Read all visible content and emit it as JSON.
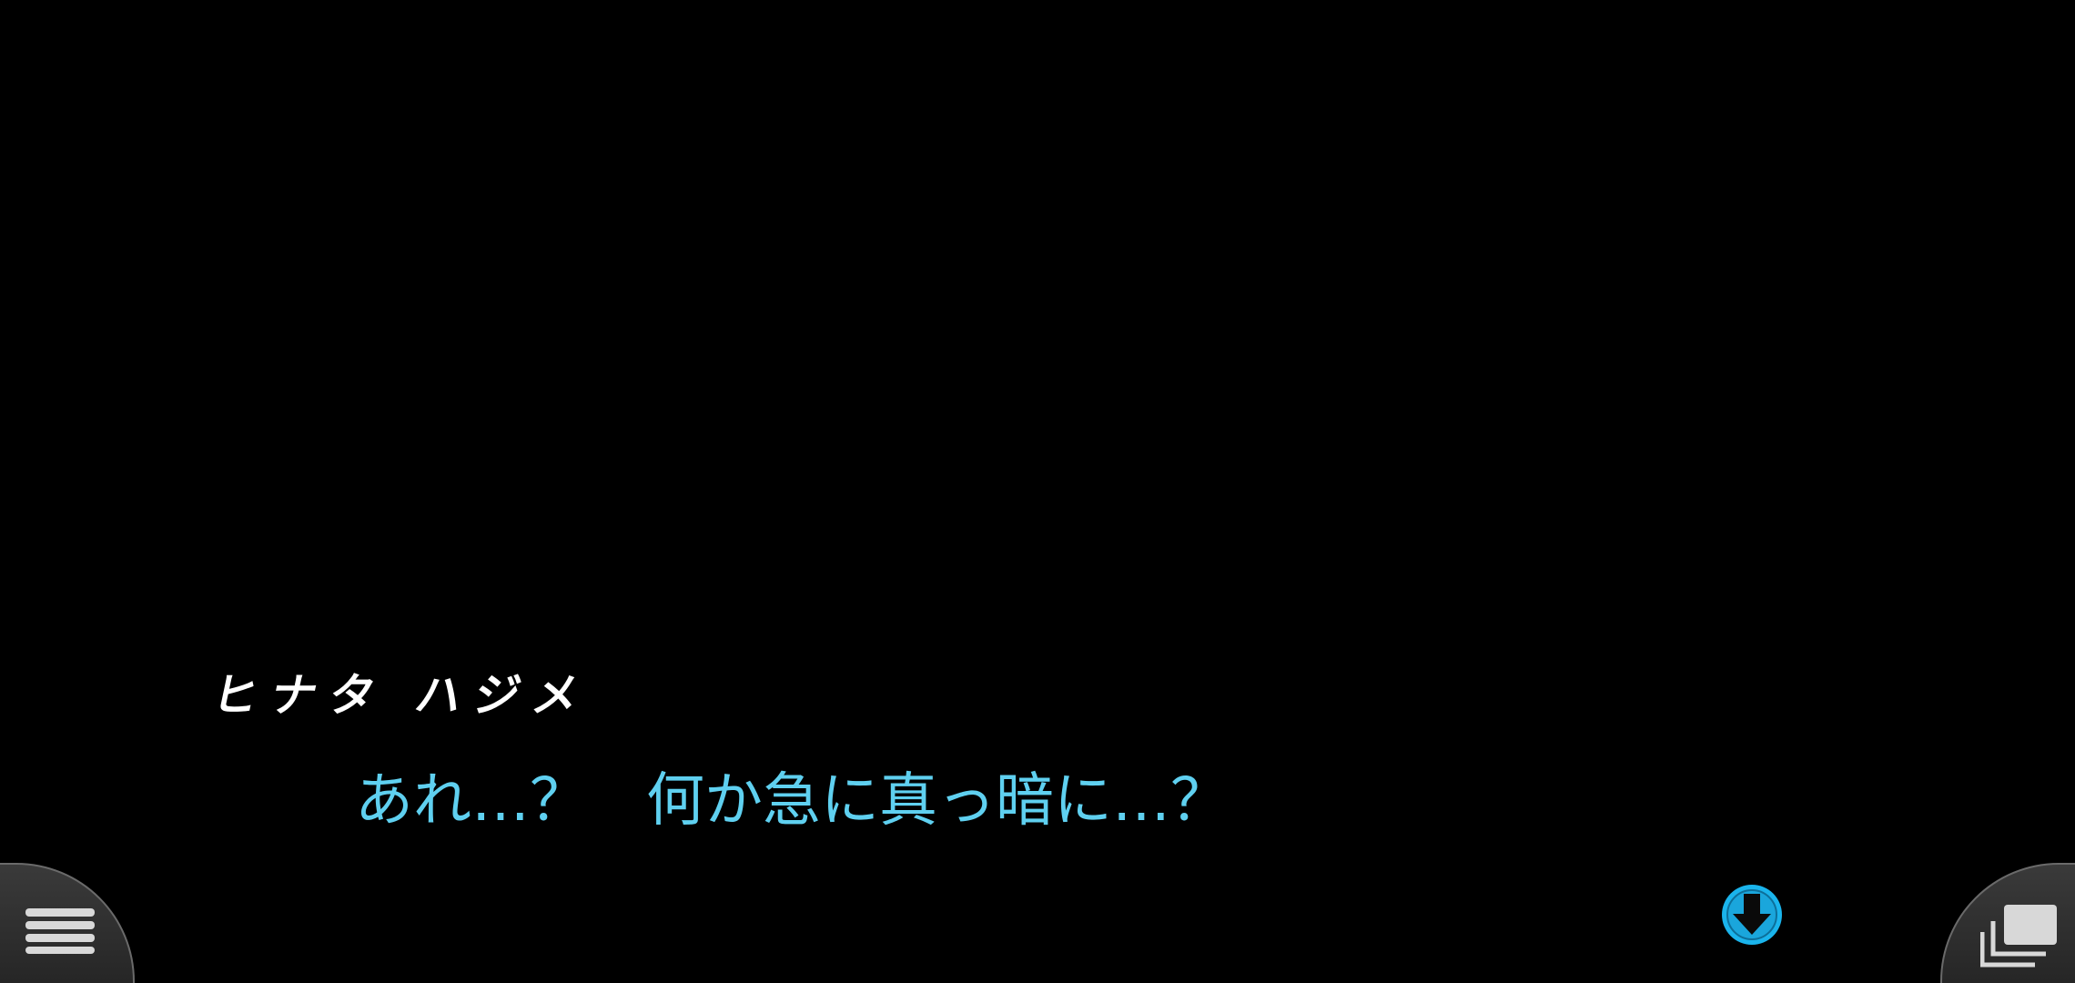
{
  "dialogue_box": {
    "speaker_name": "ヒナタ ハジメ",
    "text": "あれ…？　何か急に真っ暗に…？"
  },
  "controls": {
    "menu_icon": "hamburger-menu-icon",
    "log_icon": "stacked-windows-icon",
    "advance_icon": "down-arrow-circle-icon"
  },
  "colors": {
    "background": "#000000",
    "speaker": "#ffffff",
    "dialogue": "#5fd0f0",
    "advance": "#1ab4ec",
    "button_fill": "#333333"
  }
}
